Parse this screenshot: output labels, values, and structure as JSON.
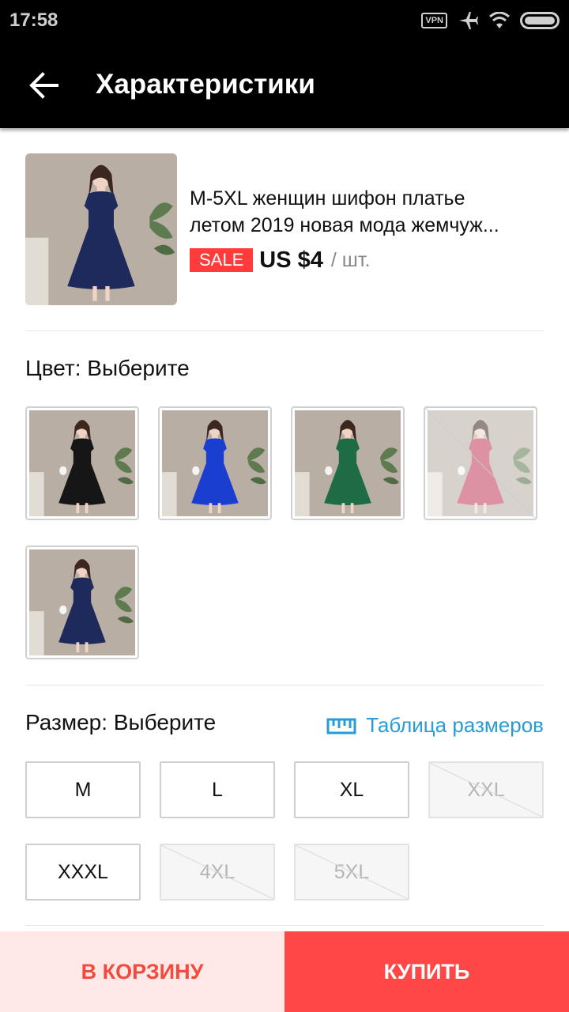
{
  "status_bar": {
    "time": "17:58",
    "vpn_label": "VPN",
    "icons": [
      "airplane-mode-icon",
      "wifi-icon",
      "battery-icon"
    ]
  },
  "header": {
    "back_icon": "arrow-left-icon",
    "title": "Характеристики"
  },
  "product": {
    "title_line1": "M-5XL женщин шифон платье",
    "title_line2": "летом 2019 новая мода жемчуж...",
    "sale_label": "SALE",
    "price": "US $4",
    "unit": "/ шт.",
    "dress_color": "#1f2a5c"
  },
  "color_section": {
    "label": "Цвет: Выберите",
    "options": [
      {
        "name": "black",
        "color": "#161616",
        "available": true
      },
      {
        "name": "blue",
        "color": "#1a3fd0",
        "available": true
      },
      {
        "name": "green",
        "color": "#1f6b46",
        "available": true
      },
      {
        "name": "pink",
        "color": "#c03a55",
        "available": false
      },
      {
        "name": "navy",
        "color": "#1f2a5c",
        "available": true
      }
    ]
  },
  "size_section": {
    "label": "Размер: Выберите",
    "chart_link": "Таблица размеров",
    "chart_icon": "ruler-icon",
    "options": [
      {
        "label": "M",
        "available": true
      },
      {
        "label": "L",
        "available": true
      },
      {
        "label": "XL",
        "available": true
      },
      {
        "label": "XXL",
        "available": false
      },
      {
        "label": "XXXL",
        "available": true
      },
      {
        "label": "4XL",
        "available": false
      },
      {
        "label": "5XL",
        "available": false
      }
    ]
  },
  "actions": {
    "add_to_cart": "В КОРЗИНУ",
    "buy": "КУПИТЬ"
  },
  "colors": {
    "accent": "#ff4747",
    "cart_bg": "#ffe8e6",
    "link": "#2a9bd6"
  }
}
